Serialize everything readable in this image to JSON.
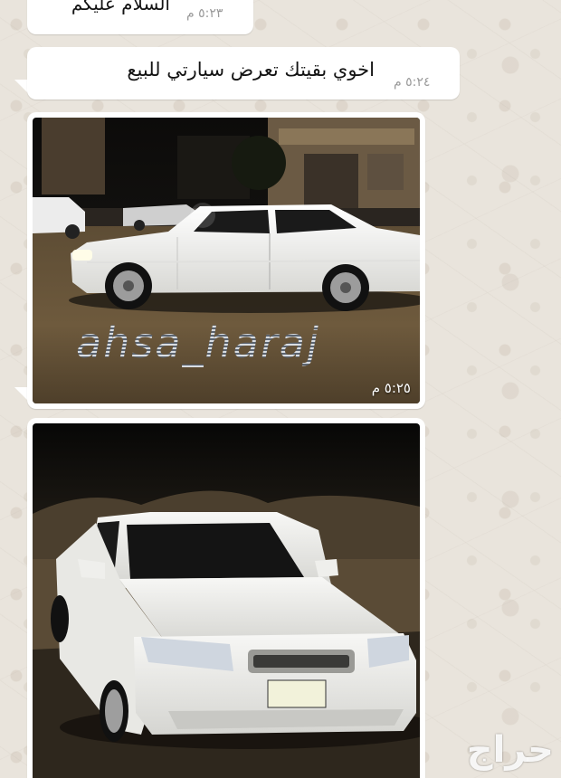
{
  "chat": {
    "messages": [
      {
        "type": "text",
        "text": "السلام عليكم",
        "time": "٥:٢٣ م"
      },
      {
        "type": "text",
        "text": "اخوي بقيتك تعرض سيارتي للبيع",
        "time": "٥:٢٤ م"
      },
      {
        "type": "image",
        "watermark": "ahsa_haraj",
        "time": "٥:٢٥ م"
      },
      {
        "type": "image",
        "time": ""
      }
    ]
  },
  "branding": {
    "logo_text": "حراج"
  },
  "colors": {
    "bubble": "#ffffff",
    "wallpaper": "#e9e4dc",
    "timestamp": "#9a9a9a",
    "car_body": "#f4f4f2"
  }
}
